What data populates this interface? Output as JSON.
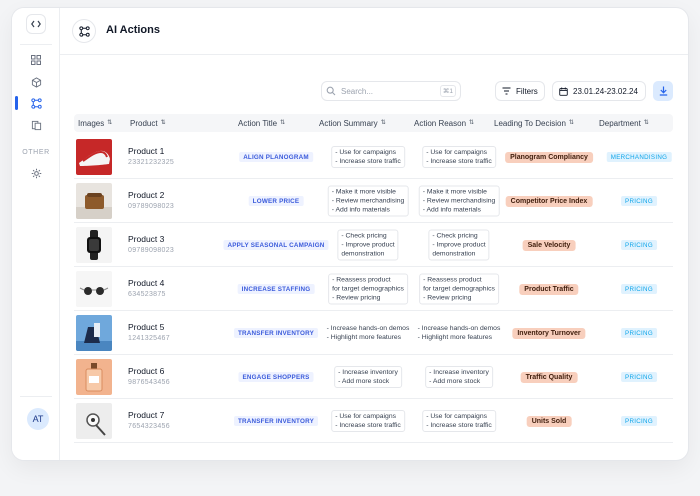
{
  "app": {
    "title": "AI Actions"
  },
  "sidebar": {
    "other_label": "OTHER",
    "user_initials": "AT"
  },
  "toolbar": {
    "search_placeholder": "Search...",
    "search_shortcut": "⌘1",
    "filters_label": "Filters",
    "date_range": "23.01.24-23.02.24"
  },
  "table": {
    "columns": [
      "Images",
      "Product",
      "Action Title",
      "Action Summary",
      "Action Reason",
      "Leading To Decision",
      "Department"
    ],
    "rows": [
      {
        "name": "Product 1",
        "id": "23321232325",
        "action": "ALIGN PLANOGRAM",
        "summary": [
          "- Use for campaigns",
          "- Increase store traffic"
        ],
        "reason": [
          "- Use for campaigns",
          "- Increase store traffic"
        ],
        "decision": "Planogram Compliancy",
        "department": "MERCHANDISING"
      },
      {
        "name": "Product 2",
        "id": "09789098023",
        "action": "LOWER PRICE",
        "summary": [
          "- Make it more visible",
          "- Review merchandising",
          "- Add info materials"
        ],
        "reason": [
          "- Make it more visible",
          "- Review merchandising",
          "- Add info materials"
        ],
        "decision": "Competitor Price Index",
        "department": "PRICING"
      },
      {
        "name": "Product 3",
        "id": "09789098023",
        "action": "APPLY SEASONAL CAMPAIGN",
        "summary": [
          "- Check pricing",
          "- Improve product",
          "demonstration"
        ],
        "reason": [
          "- Check pricing",
          "- Improve product",
          "demonstration"
        ],
        "decision": "Sale Velocity",
        "department": "PRICING"
      },
      {
        "name": "Product 4",
        "id": "634523875",
        "action": "INCREASE STAFFING",
        "summary": [
          "- Reassess product",
          "for target demographics",
          "- Review pricing"
        ],
        "reason": [
          "- Reassess product",
          "for target demographics",
          "- Review pricing"
        ],
        "decision": "Product Traffic",
        "department": "PRICING"
      },
      {
        "name": "Product 5",
        "id": "1241325467",
        "action": "TRANSFER INVENTORY",
        "summary": [
          "- Increase hands-on demos",
          "- Highlight more features"
        ],
        "reason": [
          "- Increase hands-on demos",
          "- Highlight more features"
        ],
        "decision": "Inventory Turnover",
        "department": "PRICING"
      },
      {
        "name": "Product 6",
        "id": "9876543456",
        "action": "ENGAGE SHOPPERS",
        "summary": [
          "- Increase inventory",
          "- Add more stock"
        ],
        "reason": [
          "- Increase inventory",
          "- Add more stock"
        ],
        "decision": "Traffic Quality",
        "department": "PRICING"
      },
      {
        "name": "Product 7",
        "id": "7654323456",
        "action": "TRANSFER INVENTORY",
        "summary": [
          "- Use for campaigns",
          "- Increase store traffic"
        ],
        "reason": [
          "- Use for campaigns",
          "- Increase store traffic"
        ],
        "decision": "Units Sold",
        "department": "PRICING"
      }
    ]
  }
}
